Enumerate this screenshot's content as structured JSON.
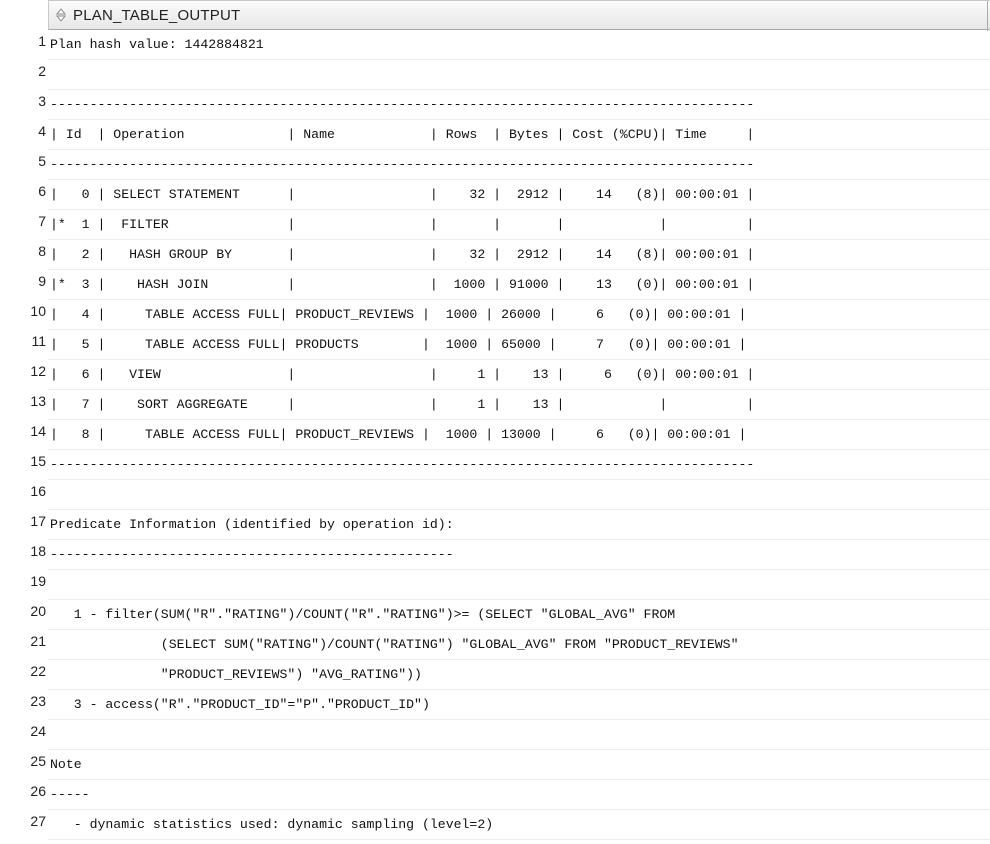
{
  "column_header": "PLAN_TABLE_OUTPUT",
  "rows": [
    {
      "n": "1",
      "text": "Plan hash value: 1442884821"
    },
    {
      "n": "2",
      "text": ""
    },
    {
      "n": "3",
      "text": "-----------------------------------------------------------------------------------------"
    },
    {
      "n": "4",
      "text": "| Id  | Operation             | Name            | Rows  | Bytes | Cost (%CPU)| Time     |"
    },
    {
      "n": "5",
      "text": "-----------------------------------------------------------------------------------------"
    },
    {
      "n": "6",
      "text": "|   0 | SELECT STATEMENT      |                 |    32 |  2912 |    14   (8)| 00:00:01 |"
    },
    {
      "n": "7",
      "text": "|*  1 |  FILTER               |                 |       |       |            |          |"
    },
    {
      "n": "8",
      "text": "|   2 |   HASH GROUP BY       |                 |    32 |  2912 |    14   (8)| 00:00:01 |"
    },
    {
      "n": "9",
      "text": "|*  3 |    HASH JOIN          |                 |  1000 | 91000 |    13   (0)| 00:00:01 |"
    },
    {
      "n": "10",
      "text": "|   4 |     TABLE ACCESS FULL| PRODUCT_REVIEWS |  1000 | 26000 |     6   (0)| 00:00:01 |"
    },
    {
      "n": "11",
      "text": "|   5 |     TABLE ACCESS FULL| PRODUCTS        |  1000 | 65000 |     7   (0)| 00:00:01 |"
    },
    {
      "n": "12",
      "text": "|   6 |   VIEW                |                 |     1 |    13 |     6   (0)| 00:00:01 |"
    },
    {
      "n": "13",
      "text": "|   7 |    SORT AGGREGATE     |                 |     1 |    13 |            |          |"
    },
    {
      "n": "14",
      "text": "|   8 |     TABLE ACCESS FULL| PRODUCT_REVIEWS |  1000 | 13000 |     6   (0)| 00:00:01 |"
    },
    {
      "n": "15",
      "text": "-----------------------------------------------------------------------------------------"
    },
    {
      "n": "16",
      "text": ""
    },
    {
      "n": "17",
      "text": "Predicate Information (identified by operation id):"
    },
    {
      "n": "18",
      "text": "---------------------------------------------------"
    },
    {
      "n": "19",
      "text": ""
    },
    {
      "n": "20",
      "text": "   1 - filter(SUM(\"R\".\"RATING\")/COUNT(\"R\".\"RATING\")>= (SELECT \"GLOBAL_AVG\" FROM"
    },
    {
      "n": "21",
      "text": "              (SELECT SUM(\"RATING\")/COUNT(\"RATING\") \"GLOBAL_AVG\" FROM \"PRODUCT_REVIEWS\""
    },
    {
      "n": "22",
      "text": "              \"PRODUCT_REVIEWS\") \"AVG_RATING\"))"
    },
    {
      "n": "23",
      "text": "   3 - access(\"R\".\"PRODUCT_ID\"=\"P\".\"PRODUCT_ID\")"
    },
    {
      "n": "24",
      "text": ""
    },
    {
      "n": "25",
      "text": "Note"
    },
    {
      "n": "26",
      "text": "-----"
    },
    {
      "n": "27",
      "text": "   - dynamic statistics used: dynamic sampling (level=2)"
    }
  ]
}
